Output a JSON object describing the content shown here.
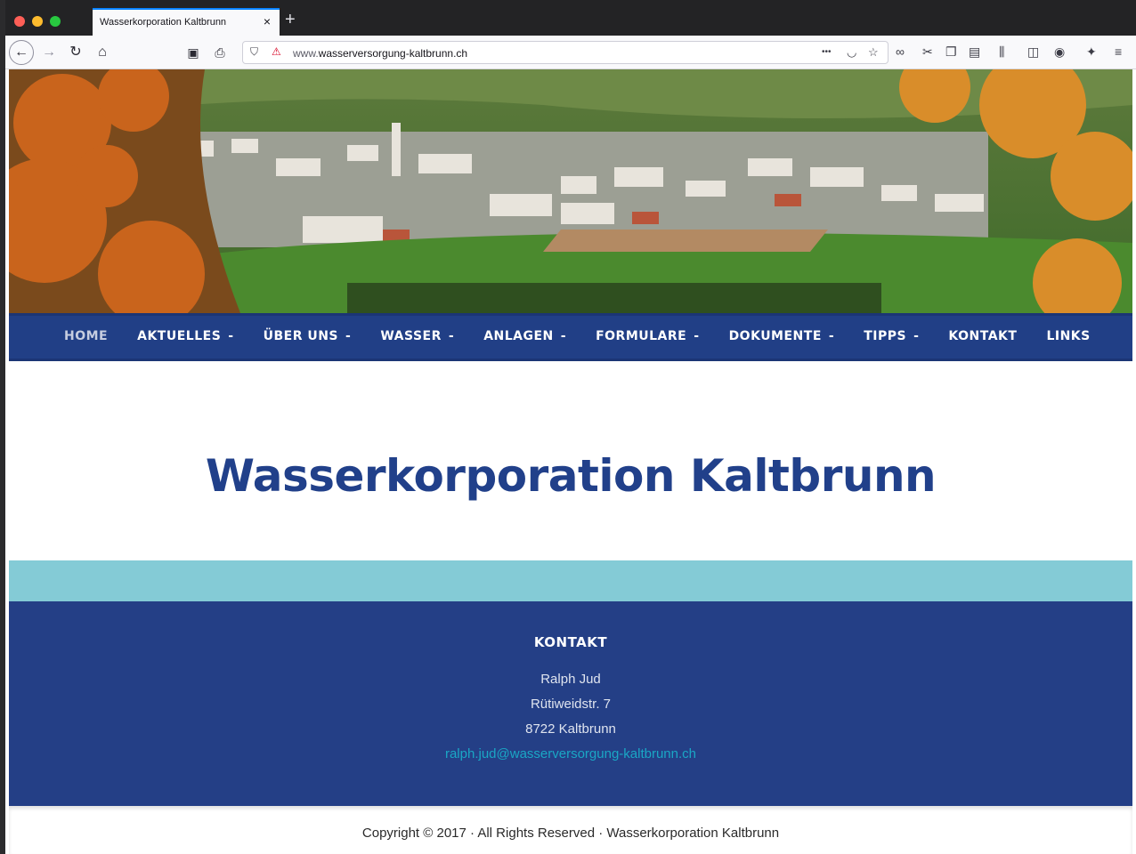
{
  "browser": {
    "tab_title": "Wasserkorporation Kaltbrunn",
    "tab_close": "×",
    "new_tab": "+",
    "url_prefix": "www.",
    "url_domain": "wasserversorgung-kaltbrunn.ch",
    "url_menu": "•••"
  },
  "nav": {
    "items": [
      {
        "label": "HOME",
        "dropdown": false
      },
      {
        "label": "AKTUELLES",
        "dropdown": true
      },
      {
        "label": "ÜBER UNS",
        "dropdown": true
      },
      {
        "label": "WASSER",
        "dropdown": true
      },
      {
        "label": "ANLAGEN",
        "dropdown": true
      },
      {
        "label": "FORMULARE",
        "dropdown": true
      },
      {
        "label": "DOKUMENTE",
        "dropdown": true
      },
      {
        "label": "TIPPS",
        "dropdown": true
      },
      {
        "label": "KONTAKT",
        "dropdown": false
      },
      {
        "label": "LINKS",
        "dropdown": false
      }
    ],
    "caret": "-"
  },
  "main": {
    "title": "Wasserkorporation Kaltbrunn"
  },
  "footer": {
    "heading": "KONTAKT",
    "name": "Ralph Jud",
    "street": "Rütiweidstr. 7",
    "city": "8722 Kaltbrunn",
    "email": "ralph.jud@wasserversorgung-kaltbrunn.ch"
  },
  "copyright": "Copyright © 2017 · All Rights Reserved · Wasserkorporation Kaltbrunn",
  "colors": {
    "nav_bg": "#213f86",
    "title": "#21408a",
    "band": "#84cbd6",
    "footer_bg": "#243f86",
    "email_link": "#1aa7c5"
  }
}
